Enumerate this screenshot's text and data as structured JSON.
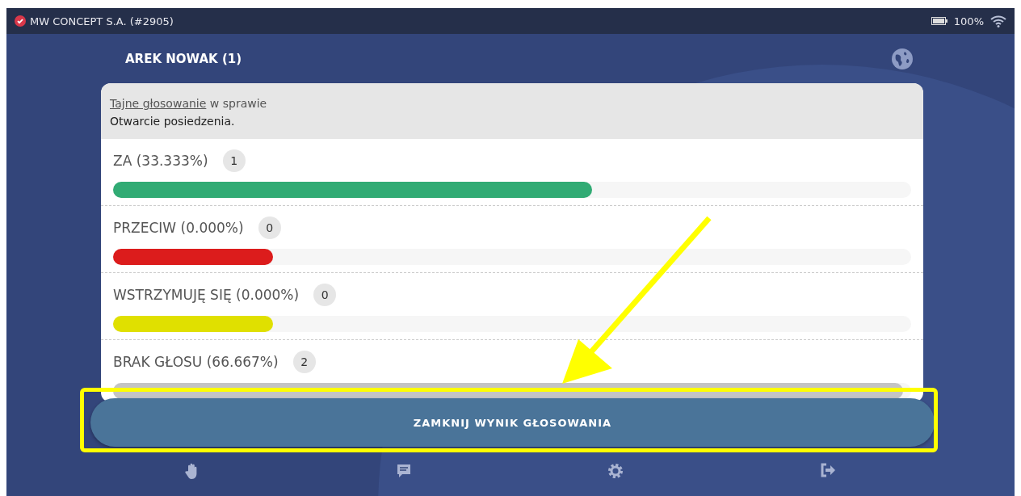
{
  "status_bar": {
    "organization": "MW CONCEPT S.A. (#2905)",
    "battery": "100%"
  },
  "header": {
    "title": "AREK NOWAK (1)"
  },
  "vote": {
    "link": "Tajne głosowanie",
    "suffix": "w sprawie",
    "subject": "Otwarcie posiedzenia.",
    "options": [
      {
        "label": "ZA (33.333%)",
        "count": "1",
        "level": 0.6,
        "color": "#31ab74"
      },
      {
        "label": "PRZECIW (0.000%)",
        "count": "0",
        "level": 0.2,
        "color": "#dc1c1c"
      },
      {
        "label": "WSTRZYMUJĘ SIĘ (0.000%)",
        "count": "0",
        "level": 0.2,
        "color": "#e0e000"
      },
      {
        "label": "BRAK GŁOSU (66.667%)",
        "count": "2",
        "level": 0.99,
        "color": "#c4c4c4"
      }
    ]
  },
  "close_button": "ZAMKNIJ WYNIK GŁOSOWANIA"
}
